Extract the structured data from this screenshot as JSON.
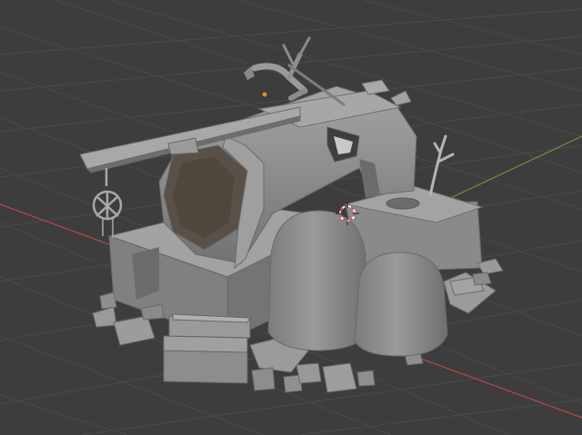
{
  "viewport": {
    "background": "#3d3d3d",
    "grid_color": "#4a4a4a",
    "x_axis_color": "#b34a4a",
    "y_axis_color": "#6a9a3a",
    "model_color": "#8e8e8e",
    "model_shadow": "#6c6c6c",
    "model_highlight": "#a6a6a6",
    "interior_color": "#5a5047",
    "cursor_color": "#d9534f",
    "origin_color": "#e5892b"
  }
}
